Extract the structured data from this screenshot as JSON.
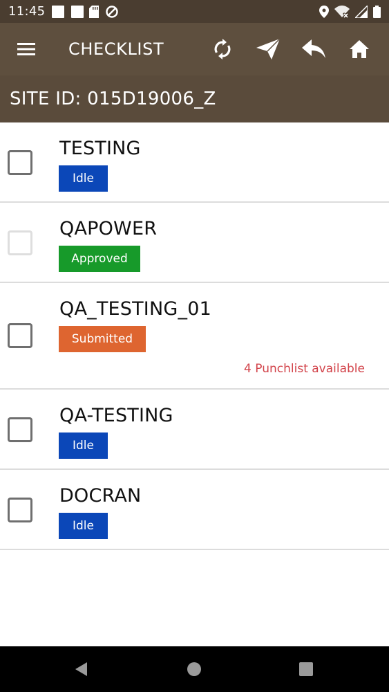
{
  "status_bar": {
    "time": "11:45",
    "icons": [
      "notification-square-icon",
      "notification-square-icon",
      "sd-card-icon",
      "do-not-disturb-icon",
      "location-icon",
      "wifi-off-icon",
      "cell-signal-icon",
      "battery-icon"
    ]
  },
  "toolbar": {
    "title": "CHECKLIST",
    "actions": [
      "menu-icon",
      "sync-icon",
      "send-icon",
      "reply-icon",
      "home-icon"
    ]
  },
  "site": {
    "label": "SITE ID: 015D19006_Z"
  },
  "checklist": [
    {
      "name": "TESTING",
      "status": "Idle",
      "status_color": "#0b47b8",
      "checkbox_enabled": true
    },
    {
      "name": "QAPOWER",
      "status": "Approved",
      "status_color": "#179a2a",
      "checkbox_enabled": false
    },
    {
      "name": "QA_TESTING_01",
      "status": "Submitted",
      "status_color": "#de6530",
      "checkbox_enabled": true,
      "note": "4 Punchlist available"
    },
    {
      "name": "QA-TESTING",
      "status": "Idle",
      "status_color": "#0b47b8",
      "checkbox_enabled": true
    },
    {
      "name": "DOCRAN",
      "status": "Idle",
      "status_color": "#0b47b8",
      "checkbox_enabled": true
    }
  ],
  "colors": {
    "toolbar": "#5e4f3e",
    "status_bar": "#4a3d30",
    "note": "#d2434a"
  }
}
